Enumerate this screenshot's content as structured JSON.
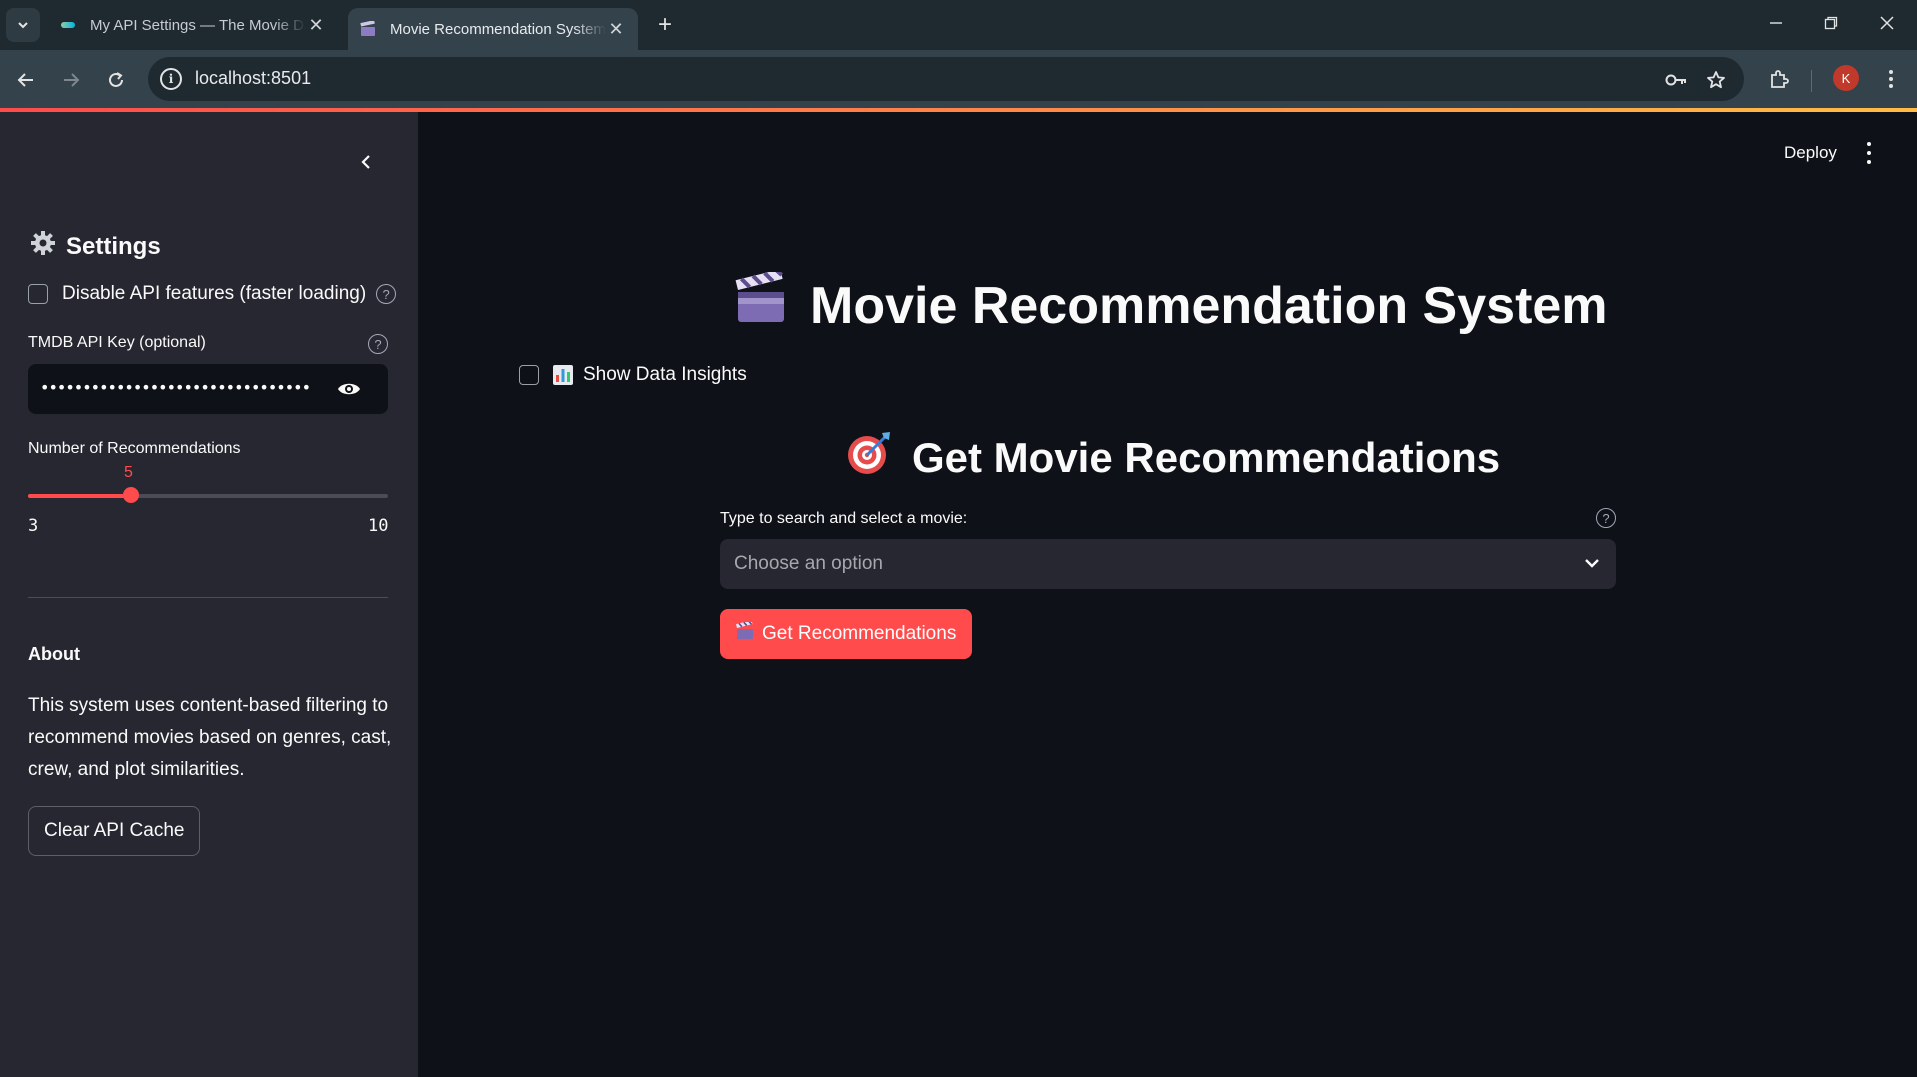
{
  "browser": {
    "tabs": [
      {
        "title": "My API Settings — The Movie Database",
        "active": false
      },
      {
        "title": "Movie Recommendation System",
        "active": true
      }
    ],
    "url": "localhost:8501",
    "profile_initial": "K"
  },
  "sidebar": {
    "settings_heading": "Settings",
    "disable_api_label": "Disable API features (faster loading)",
    "api_key_label": "TMDB API Key (optional)",
    "api_key_value": "••••••••••••••••••••••••••••••••",
    "num_recs_label": "Number of Recommendations",
    "num_recs_value": "5",
    "num_recs_min": "3",
    "num_recs_max": "10",
    "num_recs_fraction": 0.2857,
    "about_heading": "About",
    "about_text": "This system uses content-based filtering to recommend movies based on genres, cast, crew, and plot similarities.",
    "clear_cache_label": "Clear API Cache"
  },
  "header": {
    "deploy_label": "Deploy"
  },
  "main": {
    "title": "Movie Recommendation System",
    "show_insights_label": "Show Data Insights",
    "section_title": "Get Movie Recommendations",
    "select_label": "Type to search and select a movie:",
    "select_placeholder": "Choose an option",
    "button_label": "Get Recommendations"
  },
  "colors": {
    "accent": "#ff4b4b",
    "background": "#0e1117",
    "sidebar": "#262730",
    "text": "#fafafa"
  },
  "icons": [
    "clapper-board-icon",
    "target-icon",
    "bar-chart-icon",
    "gear-icon",
    "eye-icon",
    "help-icon",
    "chevron-down-icon",
    "chevron-left-icon",
    "key-icon",
    "star-icon",
    "extensions-icon"
  ]
}
